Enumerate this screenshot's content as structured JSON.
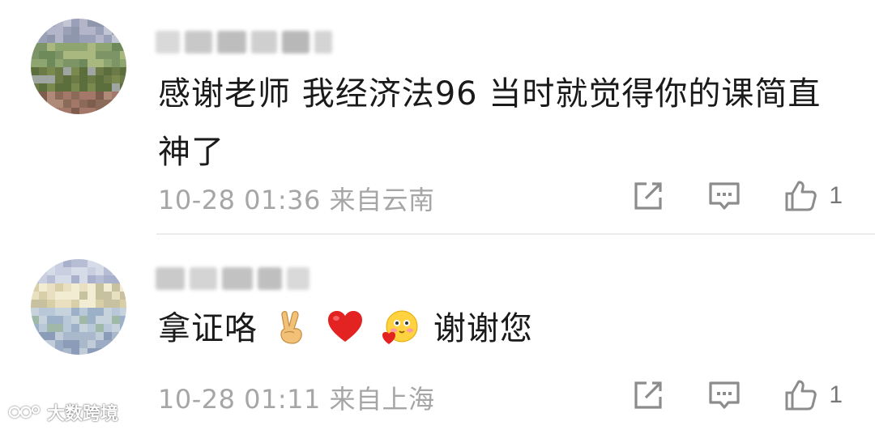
{
  "comments": [
    {
      "text": "感谢老师  我经济法96  当时就觉得你的课简直神了",
      "timestamp": "10-28 01:36",
      "location": "来自云南",
      "like_count": "1"
    },
    {
      "text_prefix": "拿证咯",
      "text_suffix": "谢谢您",
      "emojis": [
        "victory-hand",
        "red-heart",
        "blushing-face-with-heart"
      ],
      "timestamp": "10-28 01:11",
      "location": "来自上海",
      "like_count": "1"
    }
  ],
  "icons": {
    "share": "share-icon",
    "reply": "reply-icon",
    "like": "thumbs-up-icon"
  },
  "colors": {
    "text": "#1a1a1a",
    "meta": "#a6a6a6",
    "icon": "#8c8c8c",
    "divider": "#ececec"
  },
  "watermark": {
    "label": "大数跨境"
  }
}
